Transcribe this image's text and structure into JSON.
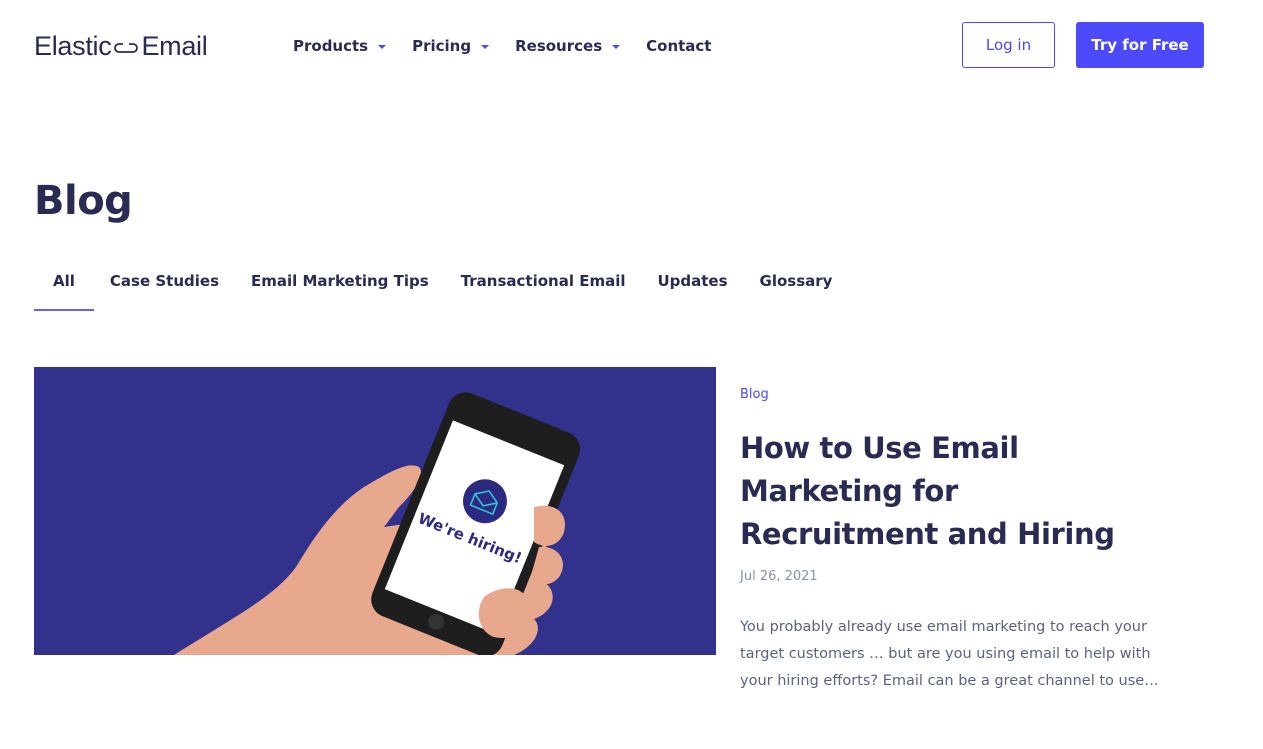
{
  "header": {
    "logo": {
      "word1": "Elastic",
      "word2": "Email",
      "icon": "link-icon"
    },
    "nav": [
      {
        "label": "Products",
        "has_dropdown": true
      },
      {
        "label": "Pricing",
        "has_dropdown": true
      },
      {
        "label": "Resources",
        "has_dropdown": true
      },
      {
        "label": "Contact",
        "has_dropdown": false
      }
    ],
    "login_label": "Log in",
    "try_label": "Try for Free"
  },
  "page": {
    "title": "Blog",
    "tabs": [
      {
        "label": "All",
        "active": true
      },
      {
        "label": "Case Studies",
        "active": false
      },
      {
        "label": "Email Marketing Tips",
        "active": false
      },
      {
        "label": "Transactional Email",
        "active": false
      },
      {
        "label": "Updates",
        "active": false
      },
      {
        "label": "Glossary",
        "active": false
      }
    ]
  },
  "featured_post": {
    "image": {
      "alt": "Hand holding phone showing We're hiring!",
      "phone_text": "We're hiring!",
      "icon": "envelope-icon"
    },
    "category": "Blog",
    "title": "How to Use Email Marketing for Recruitment and Hiring",
    "date": "Jul 26, 2021",
    "excerpt": "You probably already use email marketing to reach your target customers … but are you using email to help with your hiring efforts? Email can be a great channel to use…"
  },
  "colors": {
    "brand": "#4d4afc",
    "text_dark": "#2a2b52",
    "image_bg": "#32318c",
    "muted": "#8b92a8"
  }
}
